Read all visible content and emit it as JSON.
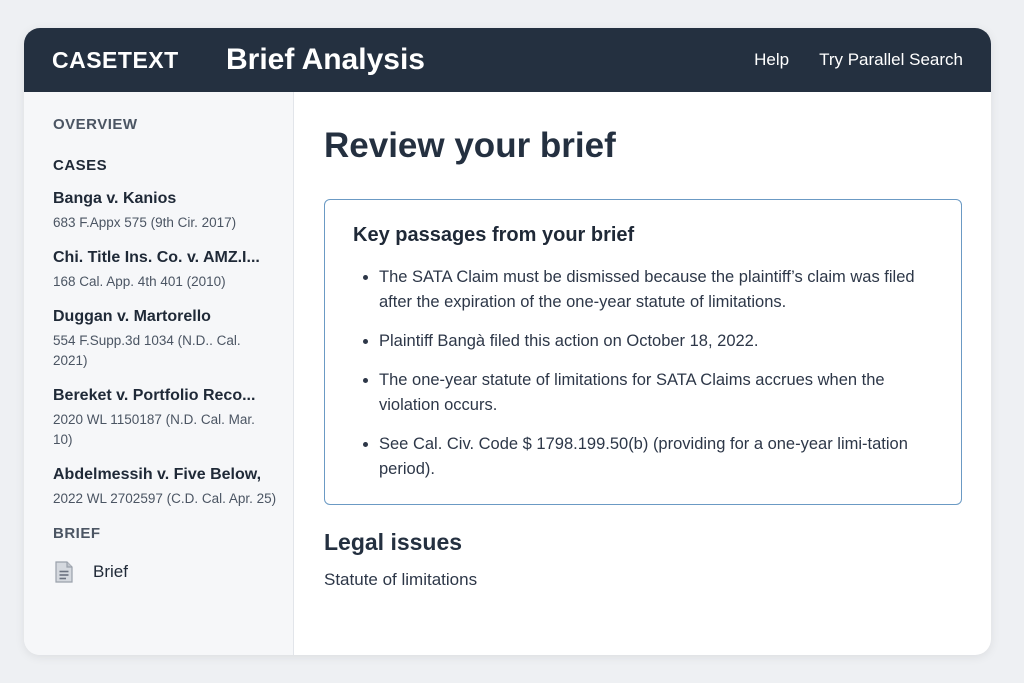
{
  "header": {
    "brand": "CASETEXT",
    "title": "Brief Analysis",
    "nav": [
      "Help",
      "Try Parallel Search"
    ]
  },
  "sidebar": {
    "overview_label": "OVERVIEW",
    "cases_label": "CASES",
    "cases": [
      {
        "name": "Banga v. Kanios",
        "cite": "683 F.Appx 575 (9th Cir. 2017)"
      },
      {
        "name": "Chi. Title Ins. Co. v. AMZ.I...",
        "cite": "168 Cal. App. 4th 401 (2010)"
      },
      {
        "name": "Duggan v. Martorello",
        "cite": "554 F.Supp.3d 1034 (N.D.. Cal. 2021)"
      },
      {
        "name": "Bereket v. Portfolio Reco...",
        "cite": "2020 WL 1150187 (N.D. Cal. Mar. 10)"
      },
      {
        "name": "Abdelmessih v. Five Below,",
        "cite": "2022 WL 2702597 (C.D. Cal. Apr. 25)"
      }
    ],
    "brief_label": "BRIEF",
    "brief_link": "Brief",
    "brief_icon": "document-icon"
  },
  "main": {
    "page_title": "Review your brief",
    "passages_title": "Key passages from your brief",
    "passages": [
      "The SATA Claim must be dismissed because the plaintiff’s claim was filed after the expiration of the one-year statute of limitations.",
      "Plaintiff Bangà filed this action on October 18, 2022.",
      "The one-year statute of limitations for SATA Claims accrues when the violation occurs.",
      "See Cal. Civ. Code $ 1798.199.50(b) (providing for a one-year limi-tation period)."
    ],
    "issues_title": "Legal issues",
    "issues": [
      "Statute of limitations"
    ]
  }
}
